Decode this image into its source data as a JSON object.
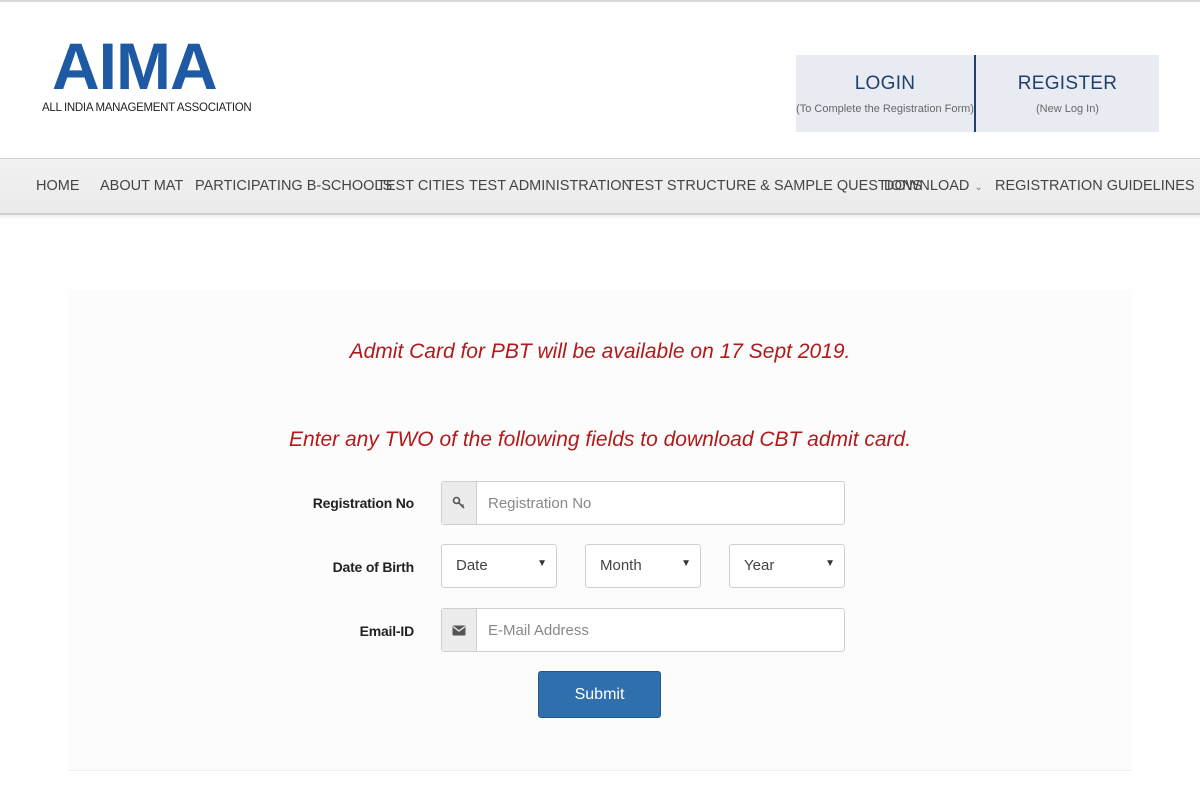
{
  "header": {
    "logo_text": "AIMA",
    "logo_subtitle": "ALL INDIA MANAGEMENT ASSOCIATION",
    "login": {
      "title": "LOGIN",
      "note": "(To Complete the Registration Form)"
    },
    "register": {
      "title": "REGISTER",
      "note": "(New Log In)"
    },
    "accent_color": "#1d5aa3"
  },
  "nav": {
    "items": [
      {
        "label": "HOME"
      },
      {
        "label": "ABOUT MAT"
      },
      {
        "label": "PARTICIPATING B-SCHOOLS"
      },
      {
        "label": "TEST CITIES"
      },
      {
        "label": "TEST ADMINISTRATION"
      },
      {
        "label": "TEST STRUCTURE & SAMPLE QUESTIONS"
      },
      {
        "label": "DOWNLOAD",
        "icon": "chevron-down-icon"
      },
      {
        "label": "REGISTRATION GUIDELINES"
      }
    ]
  },
  "main": {
    "notice_pbt": "Admit Card for PBT will be available on 17 Sept 2019.",
    "notice_cbt": "Enter any TWO of the following fields to download CBT admit card.",
    "notice_color": "#b11a1a",
    "form": {
      "registration_label": "Registration No",
      "registration_placeholder": "Registration No",
      "registration_icon": "key-icon",
      "dob_label": "Date of Birth",
      "dob_date": "Date",
      "dob_month": "Month",
      "dob_year": "Year",
      "email_label": "Email-ID",
      "email_placeholder": "E-Mail Address",
      "email_icon": "envelope-icon",
      "submit_label": "Submit",
      "submit_color": "#2f6fae"
    }
  }
}
